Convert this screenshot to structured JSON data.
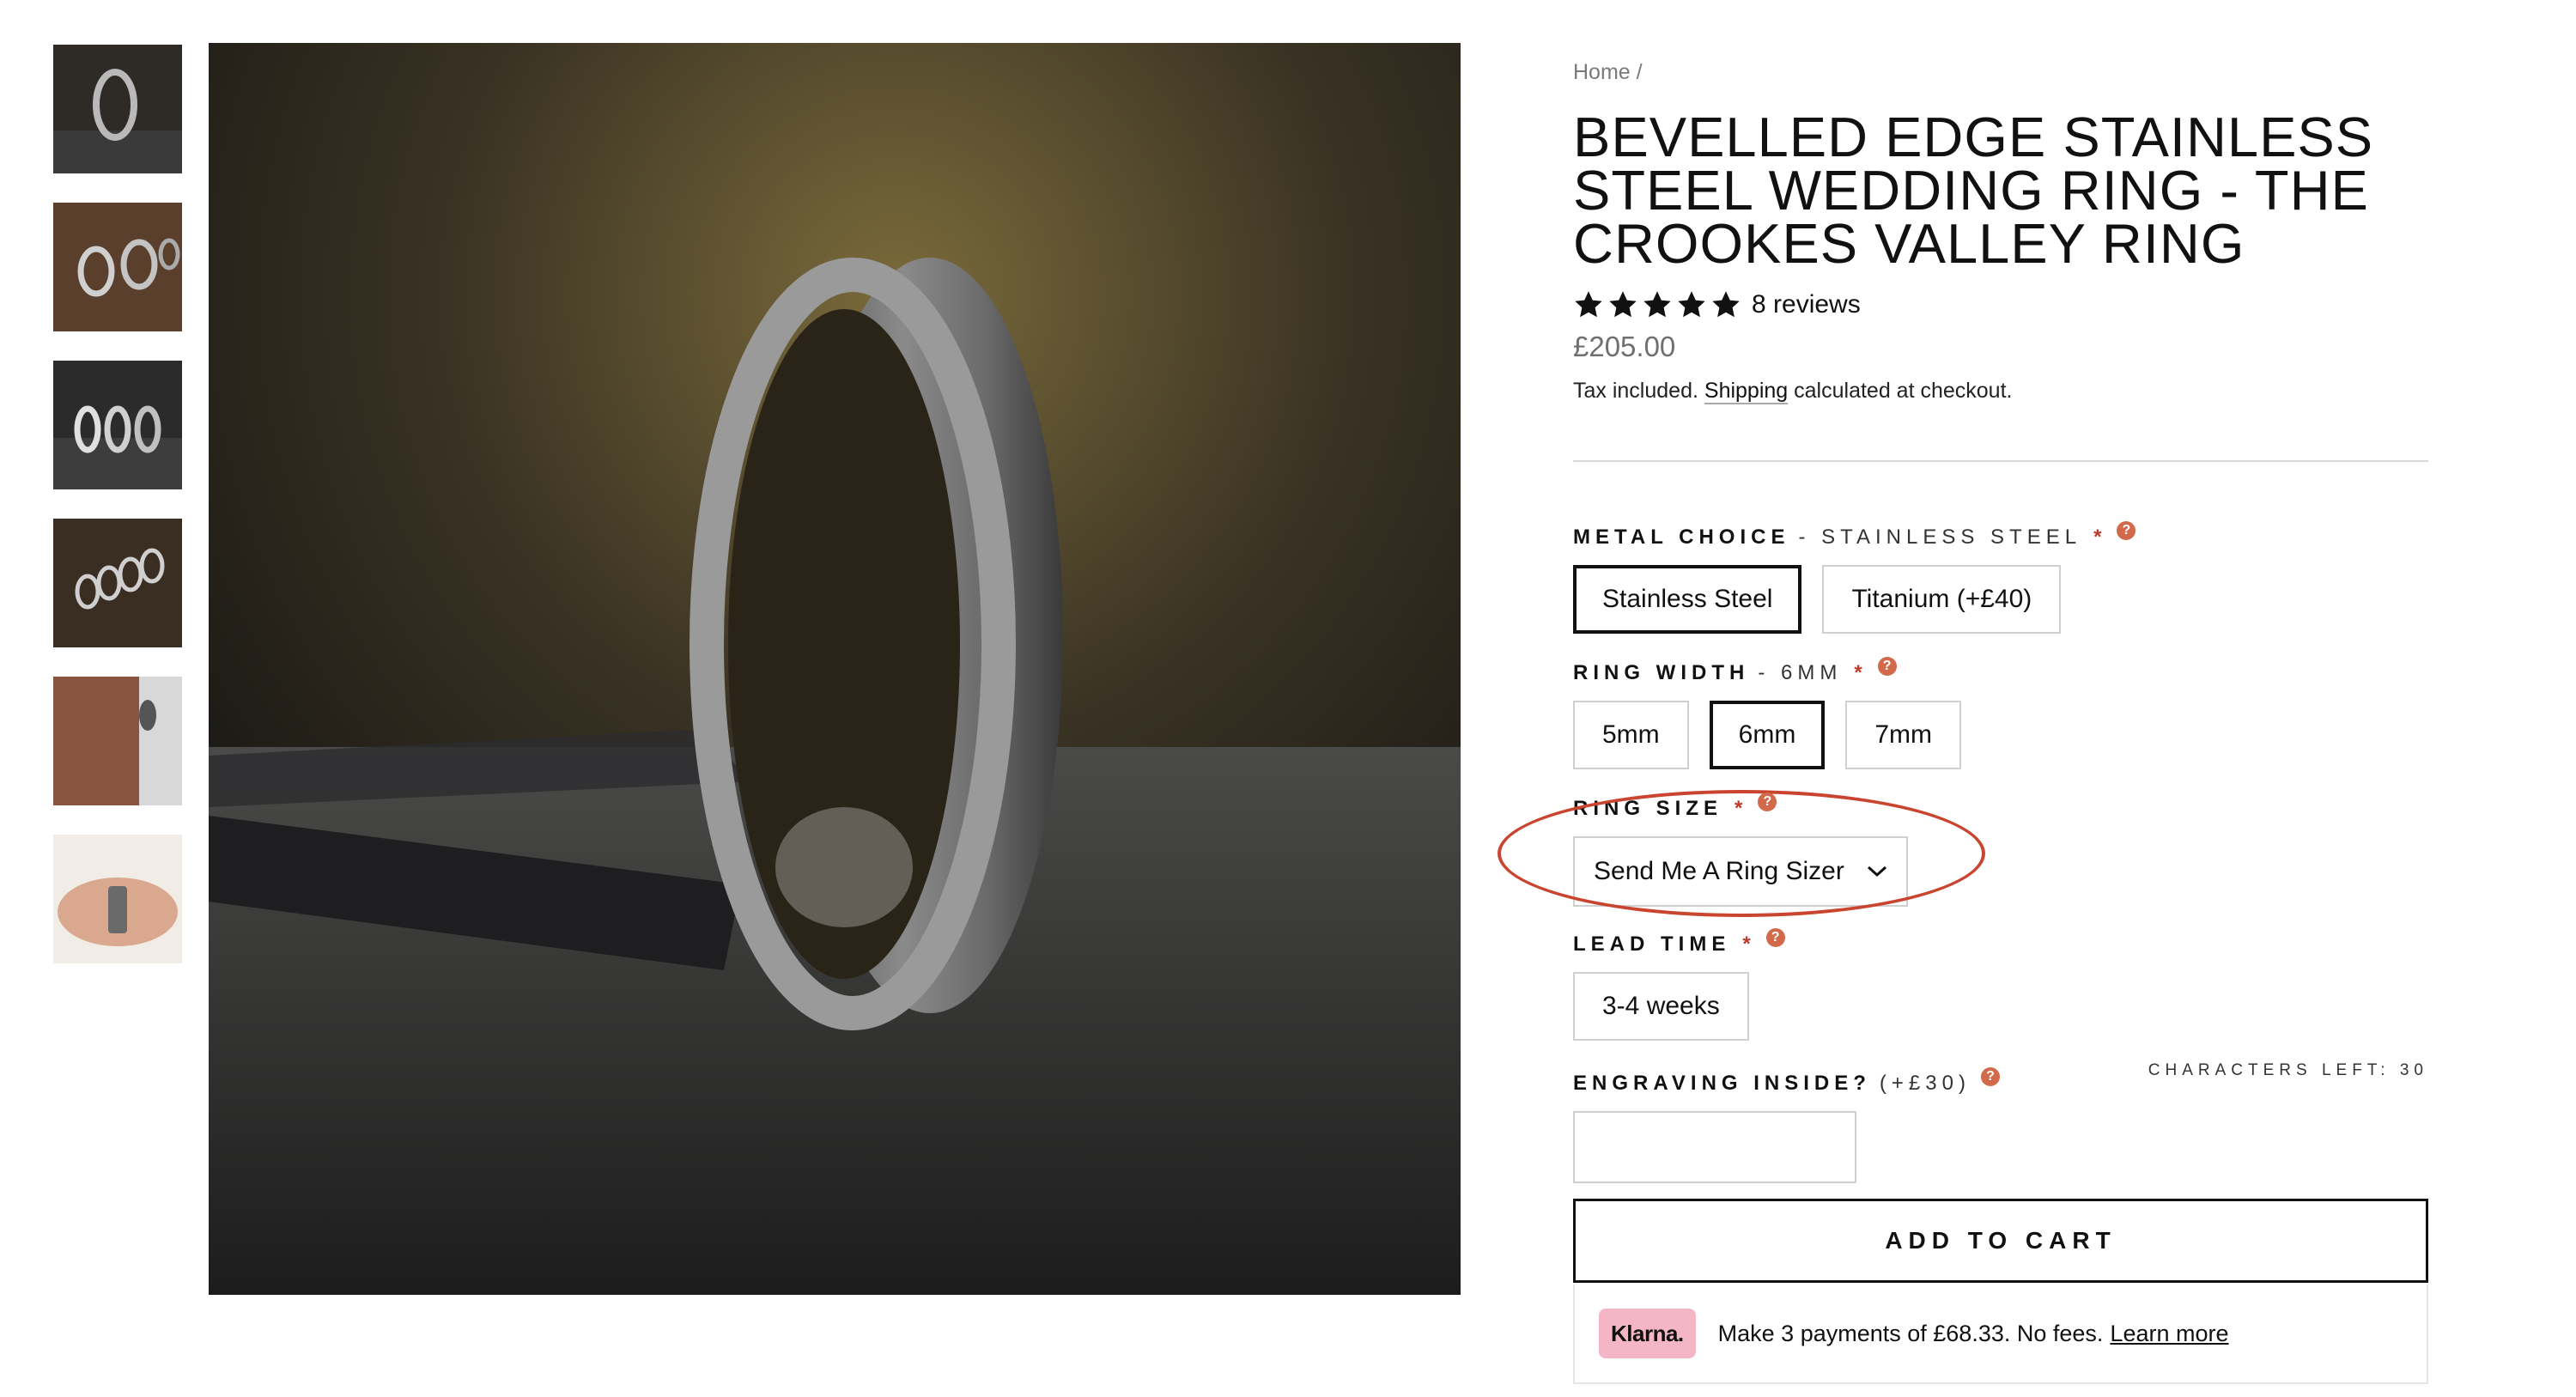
{
  "thumbnails": [
    {
      "alt": "ring-on-workbench"
    },
    {
      "alt": "rings-on-wood"
    },
    {
      "alt": "ring-row"
    },
    {
      "alt": "rings-on-wood-dark"
    },
    {
      "alt": "ring-engraving"
    },
    {
      "alt": "ring-on-finger"
    }
  ],
  "breadcrumb": {
    "home": "Home",
    "separator": "/"
  },
  "product": {
    "title": "BEVELLED EDGE STAINLESS STEEL WEDDING RING - THE CROOKES VALLEY RING",
    "rating": 5,
    "reviews": "8 reviews",
    "price": "£205.00",
    "tax_prefix": "Tax included.",
    "shipping_link": "Shipping",
    "tax_suffix": "calculated at checkout."
  },
  "options": {
    "metal": {
      "label": "METAL CHOICE",
      "selected": "- STAINLESS STEEL",
      "required": "*",
      "help": "?",
      "choices": [
        "Stainless Steel",
        "Titanium (+£40)"
      ]
    },
    "width": {
      "label": "RING WIDTH",
      "selected": "- 6MM",
      "required": "*",
      "help": "?",
      "choices": [
        "5mm",
        "6mm",
        "7mm"
      ]
    },
    "size": {
      "label": "RING SIZE",
      "required": "*",
      "help": "?",
      "value": "Send Me A Ring Sizer"
    },
    "lead": {
      "label": "LEAD TIME",
      "required": "*",
      "help": "?",
      "choices": [
        "3-4 weeks"
      ]
    },
    "engraving": {
      "label": "ENGRAVING INSIDE?",
      "price": "(+£30)",
      "help": "?",
      "chars_left": "CHARACTERS LEFT: 30",
      "value": ""
    }
  },
  "cart": {
    "add_label": "ADD TO CART"
  },
  "klarna": {
    "badge": "Klarna.",
    "text": "Make 3 payments of £68.33. No fees.",
    "link": "Learn more"
  },
  "colors": {
    "accent": "#c9452f",
    "help": "#d2694a",
    "klarna": "#f4b6c7"
  }
}
